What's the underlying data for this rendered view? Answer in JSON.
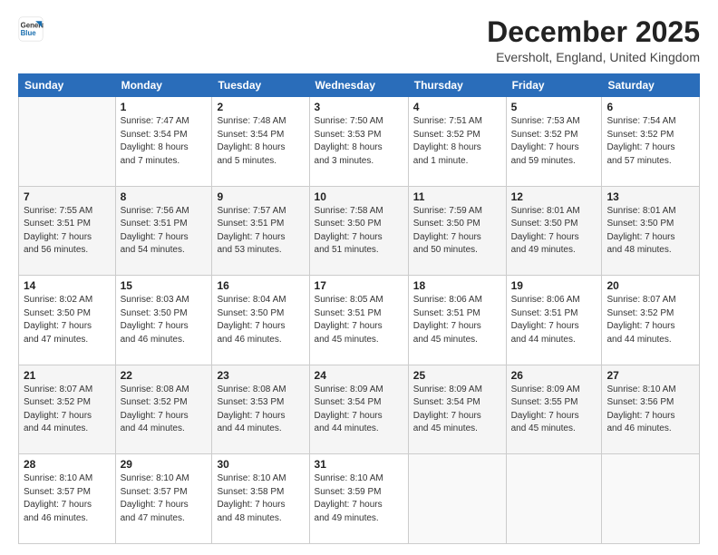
{
  "header": {
    "logo_general": "General",
    "logo_blue": "Blue",
    "month_title": "December 2025",
    "location": "Eversholt, England, United Kingdom"
  },
  "days_of_week": [
    "Sunday",
    "Monday",
    "Tuesday",
    "Wednesday",
    "Thursday",
    "Friday",
    "Saturday"
  ],
  "weeks": [
    [
      {
        "day": "",
        "info": ""
      },
      {
        "day": "1",
        "info": "Sunrise: 7:47 AM\nSunset: 3:54 PM\nDaylight: 8 hours\nand 7 minutes."
      },
      {
        "day": "2",
        "info": "Sunrise: 7:48 AM\nSunset: 3:54 PM\nDaylight: 8 hours\nand 5 minutes."
      },
      {
        "day": "3",
        "info": "Sunrise: 7:50 AM\nSunset: 3:53 PM\nDaylight: 8 hours\nand 3 minutes."
      },
      {
        "day": "4",
        "info": "Sunrise: 7:51 AM\nSunset: 3:52 PM\nDaylight: 8 hours\nand 1 minute."
      },
      {
        "day": "5",
        "info": "Sunrise: 7:53 AM\nSunset: 3:52 PM\nDaylight: 7 hours\nand 59 minutes."
      },
      {
        "day": "6",
        "info": "Sunrise: 7:54 AM\nSunset: 3:52 PM\nDaylight: 7 hours\nand 57 minutes."
      }
    ],
    [
      {
        "day": "7",
        "info": "Sunrise: 7:55 AM\nSunset: 3:51 PM\nDaylight: 7 hours\nand 56 minutes."
      },
      {
        "day": "8",
        "info": "Sunrise: 7:56 AM\nSunset: 3:51 PM\nDaylight: 7 hours\nand 54 minutes."
      },
      {
        "day": "9",
        "info": "Sunrise: 7:57 AM\nSunset: 3:51 PM\nDaylight: 7 hours\nand 53 minutes."
      },
      {
        "day": "10",
        "info": "Sunrise: 7:58 AM\nSunset: 3:50 PM\nDaylight: 7 hours\nand 51 minutes."
      },
      {
        "day": "11",
        "info": "Sunrise: 7:59 AM\nSunset: 3:50 PM\nDaylight: 7 hours\nand 50 minutes."
      },
      {
        "day": "12",
        "info": "Sunrise: 8:01 AM\nSunset: 3:50 PM\nDaylight: 7 hours\nand 49 minutes."
      },
      {
        "day": "13",
        "info": "Sunrise: 8:01 AM\nSunset: 3:50 PM\nDaylight: 7 hours\nand 48 minutes."
      }
    ],
    [
      {
        "day": "14",
        "info": "Sunrise: 8:02 AM\nSunset: 3:50 PM\nDaylight: 7 hours\nand 47 minutes."
      },
      {
        "day": "15",
        "info": "Sunrise: 8:03 AM\nSunset: 3:50 PM\nDaylight: 7 hours\nand 46 minutes."
      },
      {
        "day": "16",
        "info": "Sunrise: 8:04 AM\nSunset: 3:50 PM\nDaylight: 7 hours\nand 46 minutes."
      },
      {
        "day": "17",
        "info": "Sunrise: 8:05 AM\nSunset: 3:51 PM\nDaylight: 7 hours\nand 45 minutes."
      },
      {
        "day": "18",
        "info": "Sunrise: 8:06 AM\nSunset: 3:51 PM\nDaylight: 7 hours\nand 45 minutes."
      },
      {
        "day": "19",
        "info": "Sunrise: 8:06 AM\nSunset: 3:51 PM\nDaylight: 7 hours\nand 44 minutes."
      },
      {
        "day": "20",
        "info": "Sunrise: 8:07 AM\nSunset: 3:52 PM\nDaylight: 7 hours\nand 44 minutes."
      }
    ],
    [
      {
        "day": "21",
        "info": "Sunrise: 8:07 AM\nSunset: 3:52 PM\nDaylight: 7 hours\nand 44 minutes."
      },
      {
        "day": "22",
        "info": "Sunrise: 8:08 AM\nSunset: 3:52 PM\nDaylight: 7 hours\nand 44 minutes."
      },
      {
        "day": "23",
        "info": "Sunrise: 8:08 AM\nSunset: 3:53 PM\nDaylight: 7 hours\nand 44 minutes."
      },
      {
        "day": "24",
        "info": "Sunrise: 8:09 AM\nSunset: 3:54 PM\nDaylight: 7 hours\nand 44 minutes."
      },
      {
        "day": "25",
        "info": "Sunrise: 8:09 AM\nSunset: 3:54 PM\nDaylight: 7 hours\nand 45 minutes."
      },
      {
        "day": "26",
        "info": "Sunrise: 8:09 AM\nSunset: 3:55 PM\nDaylight: 7 hours\nand 45 minutes."
      },
      {
        "day": "27",
        "info": "Sunrise: 8:10 AM\nSunset: 3:56 PM\nDaylight: 7 hours\nand 46 minutes."
      }
    ],
    [
      {
        "day": "28",
        "info": "Sunrise: 8:10 AM\nSunset: 3:57 PM\nDaylight: 7 hours\nand 46 minutes."
      },
      {
        "day": "29",
        "info": "Sunrise: 8:10 AM\nSunset: 3:57 PM\nDaylight: 7 hours\nand 47 minutes."
      },
      {
        "day": "30",
        "info": "Sunrise: 8:10 AM\nSunset: 3:58 PM\nDaylight: 7 hours\nand 48 minutes."
      },
      {
        "day": "31",
        "info": "Sunrise: 8:10 AM\nSunset: 3:59 PM\nDaylight: 7 hours\nand 49 minutes."
      },
      {
        "day": "",
        "info": ""
      },
      {
        "day": "",
        "info": ""
      },
      {
        "day": "",
        "info": ""
      }
    ]
  ]
}
